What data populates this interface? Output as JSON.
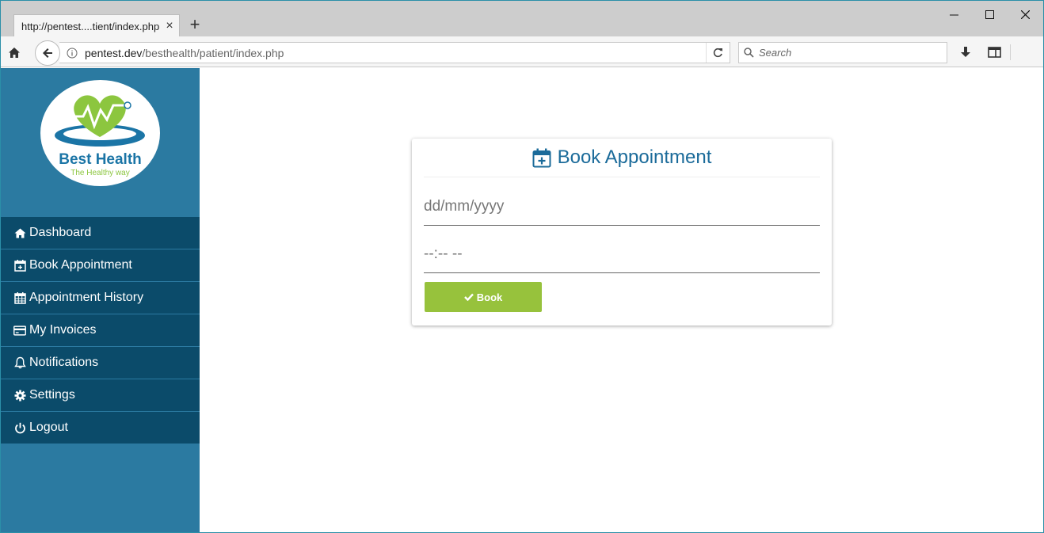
{
  "browser": {
    "tab_title": "http://pentest....tient/index.php",
    "tab_close": "×",
    "new_tab": "+",
    "url_host": "pentest.dev",
    "url_path": "/besthealth/patient/index.php",
    "search_placeholder": "Search"
  },
  "brand": {
    "name": "Best Health",
    "tagline": "The Healthy way",
    "colors": {
      "blue": "#1b75a6",
      "green": "#8cc63f"
    }
  },
  "sidebar": {
    "items": [
      {
        "label": "Dashboard",
        "icon": "home-icon"
      },
      {
        "label": "Book Appointment",
        "icon": "calendar-plus-icon"
      },
      {
        "label": "Appointment History",
        "icon": "calendar-icon"
      },
      {
        "label": "My Invoices",
        "icon": "credit-card-icon"
      },
      {
        "label": "Notifications",
        "icon": "bell-icon"
      },
      {
        "label": "Settings",
        "icon": "gear-icon"
      },
      {
        "label": "Logout",
        "icon": "power-icon"
      }
    ]
  },
  "card": {
    "title": "Book Appointment",
    "date_placeholder": "dd/mm/yyyy",
    "time_placeholder": "--:-- --",
    "book_label": "Book"
  },
  "colors": {
    "sidebar_bg": "#2b7aa1",
    "menu_bg": "#0b4b6a",
    "accent_green": "#97c23c",
    "header_blue": "#1b6b9a"
  }
}
